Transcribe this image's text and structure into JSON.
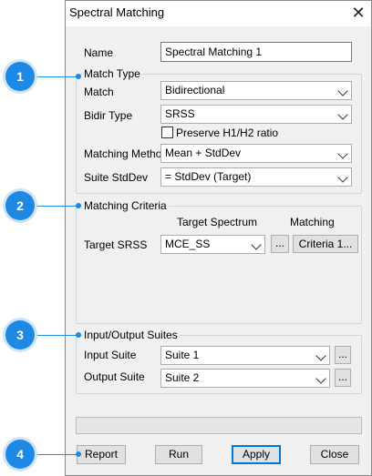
{
  "window": {
    "title": "Spectral Matching",
    "close_glyph": "✕"
  },
  "name_field": {
    "label": "Name",
    "value": "Spectral Matching 1"
  },
  "match_type": {
    "legend": "Match Type",
    "match_label": "Match",
    "match_value": "Bidirectional",
    "bidir_label": "Bidir Type",
    "bidir_value": "SRSS",
    "preserve_label": "Preserve H1/H2 ratio",
    "preserve_checked": false,
    "method_label": "Matching Method",
    "method_value": "Mean + StdDev",
    "suite_std_label": "Suite StdDev",
    "suite_std_value": "= StdDev (Target)"
  },
  "criteria": {
    "legend": "Matching Criteria",
    "col_target": "Target Spectrum",
    "col_matching": "Matching",
    "row_label": "Target SRSS",
    "target_value": "MCE_SS",
    "browse": "...",
    "criteria_btn": "Criteria 1..."
  },
  "suites": {
    "legend": "Input/Output Suites",
    "input_label": "Input Suite",
    "input_value": "Suite 1",
    "output_label": "Output Suite",
    "output_value": "Suite 2",
    "browse": "..."
  },
  "buttons": {
    "report": "Report",
    "run": "Run",
    "apply": "Apply",
    "close": "Close"
  },
  "callouts": [
    "1",
    "2",
    "3",
    "4"
  ],
  "colors": {
    "callout": "#1e88e5",
    "dialog_bg": "#f0f0f0",
    "focus_border": "#0078d7"
  }
}
